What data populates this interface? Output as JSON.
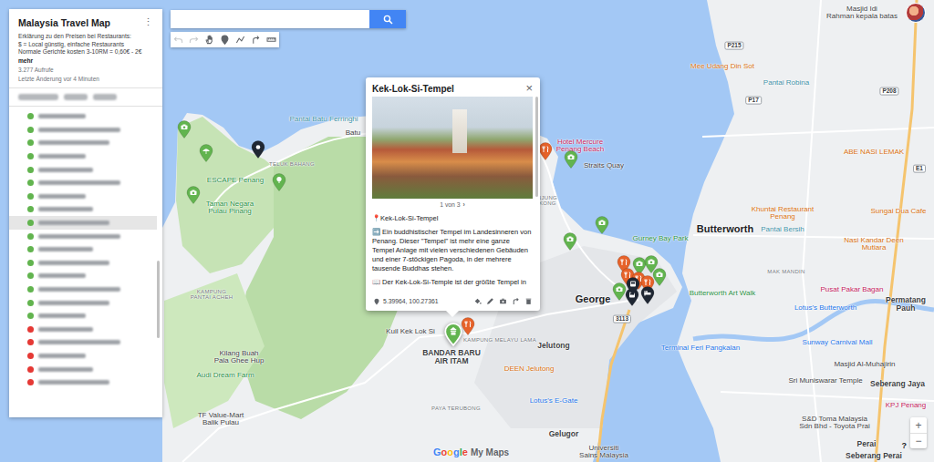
{
  "panel": {
    "title": "Malaysia Travel Map",
    "menu": "⋮",
    "description": [
      "Erklärung zu den Preisen bei Restaurants:",
      "$ = Local günstig, einfache Restaurants",
      "Normale Gerichte kosten 3-10RM = 0,60€ - 2€"
    ],
    "more": "mehr",
    "views": "3.277 Aufrufe",
    "updated": "Letzte Änderung vor 4 Minuten",
    "items": [
      {
        "color": "#62b44f",
        "selected": false
      },
      {
        "color": "#62b44f",
        "selected": false
      },
      {
        "color": "#62b44f",
        "selected": false
      },
      {
        "color": "#62b44f",
        "selected": false
      },
      {
        "color": "#62b44f",
        "selected": false
      },
      {
        "color": "#62b44f",
        "selected": false
      },
      {
        "color": "#62b44f",
        "selected": false
      },
      {
        "color": "#62b44f",
        "selected": false
      },
      {
        "color": "#62b44f",
        "selected": true
      },
      {
        "color": "#62b44f",
        "selected": false
      },
      {
        "color": "#62b44f",
        "selected": false
      },
      {
        "color": "#62b44f",
        "selected": false
      },
      {
        "color": "#62b44f",
        "selected": false
      },
      {
        "color": "#62b44f",
        "selected": false
      },
      {
        "color": "#62b44f",
        "selected": false
      },
      {
        "color": "#62b44f",
        "selected": false
      },
      {
        "color": "#e53935",
        "selected": false
      },
      {
        "color": "#e53935",
        "selected": false
      },
      {
        "color": "#e53935",
        "selected": false
      },
      {
        "color": "#e53935",
        "selected": false
      },
      {
        "color": "#e53935",
        "selected": false
      }
    ]
  },
  "search": {
    "value": ""
  },
  "toolbar": [
    {
      "kind": "undo",
      "disabled": true
    },
    {
      "kind": "redo",
      "disabled": true
    },
    {
      "kind": "hand",
      "disabled": false
    },
    {
      "kind": "marker",
      "disabled": false
    },
    {
      "kind": "line",
      "disabled": false
    },
    {
      "kind": "route",
      "disabled": false
    },
    {
      "kind": "ruler",
      "disabled": false
    }
  ],
  "popup": {
    "title": "Kek-Lok-Si-Tempel",
    "close": "×",
    "photo_counter": "1 von 3",
    "photo_next": "›",
    "paragraphs": [
      "📍Kek-Lok-Si-Tempel",
      "➡️ Ein buddhistischer Tempel im Landesinneren von Penang. Dieser \"Tempel\" ist mehr eine ganze Tempel Anlage mit vielen verschiedenen Gebäuden und einer 7-stöckigen Pagoda, in der mehrere tausende Buddhas stehen.",
      "📖 Der Kek-Lok-Si-Temple ist der größte Tempel in"
    ],
    "coordinates": "5.39964, 100.27361"
  },
  "pins": [
    {
      "kind": "camera",
      "color": "#62b44f",
      "selected": false
    },
    {
      "kind": "beach",
      "color": "#62b44f",
      "selected": false
    },
    {
      "kind": "park",
      "color": "#62b44f",
      "selected": false
    },
    {
      "kind": "camera",
      "color": "#62b44f",
      "selected": false
    },
    {
      "kind": "marker",
      "color": "#1f2733",
      "selected": false
    },
    {
      "kind": "food",
      "color": "#e6622a",
      "selected": false
    },
    {
      "kind": "camera",
      "color": "#62b44f",
      "selected": false
    },
    {
      "kind": "camera",
      "color": "#62b44f",
      "selected": false
    },
    {
      "kind": "camera",
      "color": "#62b44f",
      "selected": false
    },
    {
      "kind": "temple",
      "color": "#62b44f",
      "selected": true
    },
    {
      "kind": "food",
      "color": "#e6622a",
      "selected": false
    },
    {
      "kind": "food",
      "color": "#e6622a",
      "selected": false
    },
    {
      "kind": "camera",
      "color": "#62b44f",
      "selected": false
    },
    {
      "kind": "camera",
      "color": "#62b44f",
      "selected": false
    },
    {
      "kind": "camera",
      "color": "#62b44f",
      "selected": false
    },
    {
      "kind": "food",
      "color": "#e6622a",
      "selected": false
    },
    {
      "kind": "food",
      "color": "#e6622a",
      "selected": false
    },
    {
      "kind": "food",
      "color": "#e6622a",
      "selected": false
    },
    {
      "kind": "camera",
      "color": "#62b44f",
      "selected": false
    },
    {
      "kind": "bus",
      "color": "#1f2733",
      "selected": false
    },
    {
      "kind": "hotel",
      "color": "#1f2733",
      "selected": false
    },
    {
      "kind": "bus",
      "color": "#1f2733",
      "selected": false
    }
  ],
  "labels": [
    {
      "text": "Pantai Batu Ferringhi",
      "color": "#3b8fa6",
      "kind": "poi"
    },
    {
      "text": "Batu",
      "color": "#3c4043",
      "kind": "poi"
    },
    {
      "text": "TELUK BAHANG",
      "color": "#70757a",
      "kind": "area"
    },
    {
      "text": "ESCAPE Penang",
      "color": "#1e8e3e",
      "kind": "poi"
    },
    {
      "text": "Taman Negara\nPulau Pinang",
      "color": "#1e8e3e",
      "kind": "poi"
    },
    {
      "text": "KAMPUNG\nPANTAI ACHEH",
      "color": "#70757a",
      "kind": "area"
    },
    {
      "text": "Kilang Buah\nPala Ghee Hup",
      "color": "#3c4043",
      "kind": "poi"
    },
    {
      "text": "Audi Dream Farm",
      "color": "#1e8e3e",
      "kind": "poi"
    },
    {
      "text": "TF Value-Mart\nBalik Pulau",
      "color": "#3c4043",
      "kind": "poi"
    },
    {
      "text": "Kuil Kek Lok Si",
      "color": "#3c4043",
      "kind": "poi"
    },
    {
      "text": "KAMPUNG MELAYU LAMA",
      "color": "#70757a",
      "kind": "area"
    },
    {
      "text": "BANDAR BARU\nAIR ITAM",
      "color": "#3c4043",
      "kind": "town"
    },
    {
      "text": "Jelutong",
      "color": "#3c4043",
      "kind": "town"
    },
    {
      "text": "DEEN Jelutong",
      "color": "#d56e0c",
      "kind": "poi"
    },
    {
      "text": "Lotus's E-Gate",
      "color": "#1a73e8",
      "kind": "poi"
    },
    {
      "text": "PAYA TERUBONG",
      "color": "#70757a",
      "kind": "area"
    },
    {
      "text": "Gelugor",
      "color": "#3c4043",
      "kind": "town"
    },
    {
      "text": "Universiti\nSains Malaysia",
      "color": "#3c4043",
      "kind": "poi"
    },
    {
      "text": "Hotel Mercure\nPenang Beach",
      "color": "#c2185b",
      "kind": "poi"
    },
    {
      "text": "Straits Quay",
      "color": "#3c4043",
      "kind": "poi"
    },
    {
      "text": "TANJUNG\nTOKONG",
      "color": "#70757a",
      "kind": "area"
    },
    {
      "text": "Gurney Bay Park",
      "color": "#1e8e3e",
      "kind": "poi"
    },
    {
      "text": "George",
      "color": "#202124",
      "kind": "city"
    },
    {
      "text": "Butterworth",
      "color": "#202124",
      "kind": "city"
    },
    {
      "text": "Butterworth Art Walk",
      "color": "#1e8e3e",
      "kind": "poi"
    },
    {
      "text": "Pusat Pakar Bagan",
      "color": "#c2185b",
      "kind": "poi"
    },
    {
      "text": "Lotus's Butterworth",
      "color": "#1a73e8",
      "kind": "poi"
    },
    {
      "text": "Sunway Carnival Mall",
      "color": "#1a73e8",
      "kind": "poi"
    },
    {
      "text": "Terminal Feri Pangkalan",
      "color": "#1a73e8",
      "kind": "poi"
    },
    {
      "text": "Masjid Al-Muhajirin",
      "color": "#3c4043",
      "kind": "poi"
    },
    {
      "text": "Sri Muniswarar Temple",
      "color": "#3c4043",
      "kind": "poi"
    },
    {
      "text": "Seberang Jaya",
      "color": "#3c4043",
      "kind": "town"
    },
    {
      "text": "KPJ Penang",
      "color": "#c2185b",
      "kind": "poi"
    },
    {
      "text": "S&D Toma Malaysia\nSdn Bhd - Toyota Prai",
      "color": "#3c4043",
      "kind": "poi"
    },
    {
      "text": "Perai",
      "color": "#3c4043",
      "kind": "town"
    },
    {
      "text": "Seberang Perai",
      "color": "#3c4043",
      "kind": "town"
    },
    {
      "text": "Mee Udang Din Sot",
      "color": "#d56e0c",
      "kind": "poi"
    },
    {
      "text": "Pantai Robina",
      "color": "#3b8fa6",
      "kind": "poi"
    },
    {
      "text": "ABE NASI LEMAK",
      "color": "#d56e0c",
      "kind": "poi"
    },
    {
      "text": "Khuntai Restaurant\nPenang",
      "color": "#d56e0c",
      "kind": "poi"
    },
    {
      "text": "Sungai Dua Cafe",
      "color": "#d56e0c",
      "kind": "poi"
    },
    {
      "text": "Nasi Kandar Deen\nMutiara",
      "color": "#d56e0c",
      "kind": "poi"
    },
    {
      "text": "Masjid Idi\nRahman kepala batas",
      "color": "#3c4043",
      "kind": "poi"
    },
    {
      "text": "Pantai Bersih",
      "color": "#3b8fa6",
      "kind": "poi"
    },
    {
      "text": "Permatang\nPauh",
      "color": "#3c4043",
      "kind": "town"
    },
    {
      "text": "MAK MANDIN",
      "color": "#70757a",
      "kind": "area"
    },
    {
      "text": "P215",
      "color": "#3c4043",
      "kind": "shield"
    },
    {
      "text": "P17",
      "color": "#3c4043",
      "kind": "shield"
    },
    {
      "text": "P208",
      "color": "#3c4043",
      "kind": "shield"
    },
    {
      "text": "E1",
      "color": "#3c4043",
      "kind": "shield"
    },
    {
      "text": "3113",
      "color": "#3c4043",
      "kind": "shield"
    }
  ],
  "logo": {
    "letters": [
      {
        "char": "G",
        "color": "#4285f4"
      },
      {
        "char": "o",
        "color": "#ea4335"
      },
      {
        "char": "o",
        "color": "#fbbc05"
      },
      {
        "char": "g",
        "color": "#4285f4"
      },
      {
        "char": "l",
        "color": "#34a853"
      },
      {
        "char": "e",
        "color": "#ea4335"
      }
    ],
    "product": "My Maps"
  },
  "zoom": {
    "in": "+",
    "out": "−"
  },
  "help": "?"
}
